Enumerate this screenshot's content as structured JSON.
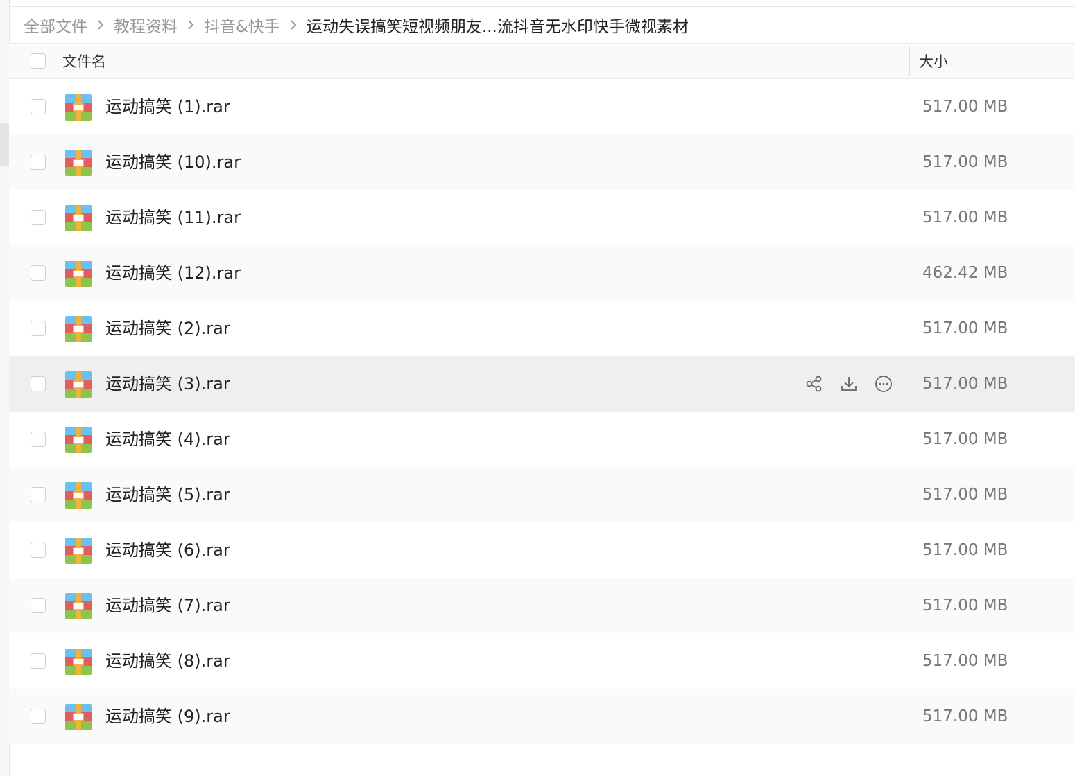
{
  "breadcrumb": [
    {
      "label": "全部文件"
    },
    {
      "label": "教程资料"
    },
    {
      "label": "抖音&快手"
    },
    {
      "label": "运动失误搞笑短视频朋友...流抖音无水印快手微视素材"
    }
  ],
  "table": {
    "col_name": "文件名",
    "col_size": "大小"
  },
  "files": [
    {
      "name": "运动搞笑 (1).rar",
      "size": "517.00 MB"
    },
    {
      "name": "运动搞笑 (10).rar",
      "size": "517.00 MB"
    },
    {
      "name": "运动搞笑 (11).rar",
      "size": "517.00 MB"
    },
    {
      "name": "运动搞笑 (12).rar",
      "size": "462.42 MB"
    },
    {
      "name": "运动搞笑 (2).rar",
      "size": "517.00 MB"
    },
    {
      "name": "运动搞笑 (3).rar",
      "size": "517.00 MB",
      "hovered": true
    },
    {
      "name": "运动搞笑 (4).rar",
      "size": "517.00 MB"
    },
    {
      "name": "运动搞笑 (5).rar",
      "size": "517.00 MB"
    },
    {
      "name": "运动搞笑 (6).rar",
      "size": "517.00 MB"
    },
    {
      "name": "运动搞笑 (7).rar",
      "size": "517.00 MB"
    },
    {
      "name": "运动搞笑 (8).rar",
      "size": "517.00 MB"
    },
    {
      "name": "运动搞笑 (9).rar",
      "size": "517.00 MB"
    }
  ],
  "row_actions": [
    "share-icon",
    "download-icon",
    "more-icon"
  ],
  "colors": {
    "rar_top": "#6cc0ef",
    "rar_mid": "#e25d5d",
    "rar_bottom": "#8dc44e",
    "rar_band": "#f0b43c"
  }
}
